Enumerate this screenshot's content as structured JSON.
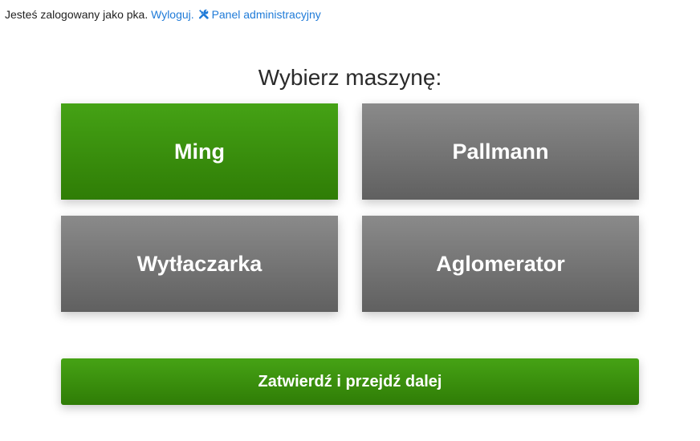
{
  "header": {
    "logged_in_prefix": "Jesteś zalogowany jako pka.",
    "logout_label": "Wyloguj.",
    "admin_icon": "tools-icon",
    "admin_label": "Panel administracyjny",
    "link_color": "#1f7bd8"
  },
  "main": {
    "title": "Wybierz maszynę:",
    "machines": [
      {
        "label": "Ming",
        "selected": true
      },
      {
        "label": "Pallmann",
        "selected": false
      },
      {
        "label": "Wytłaczarka",
        "selected": false
      },
      {
        "label": "Aglomerator",
        "selected": false
      }
    ],
    "submit_label": "Zatwierdź i przejdź dalej"
  },
  "colors": {
    "selected_green": "#3b9110",
    "unselected_gray": "#747474"
  }
}
